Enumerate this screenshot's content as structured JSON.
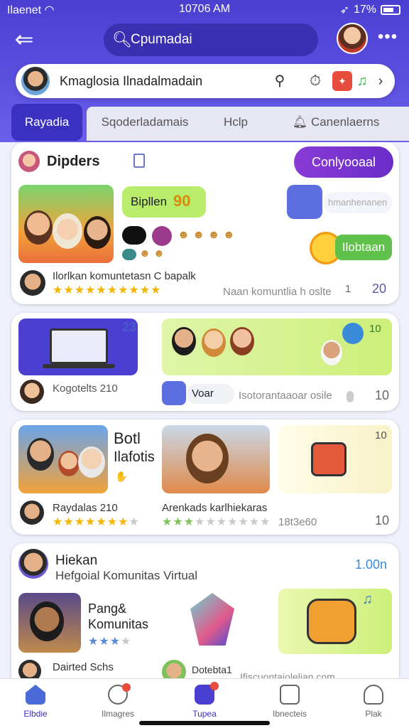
{
  "status": {
    "carrier": "Ilaenet",
    "time": "10706 AM",
    "battery": "17%"
  },
  "topbar": {
    "search_text": "Cpumadai"
  },
  "profile": {
    "name": "Kmaglosia Ilnadalmadain"
  },
  "tabs": [
    {
      "label": "Rayadia",
      "active": true
    },
    {
      "label": "Sqoderladamais",
      "active": false
    },
    {
      "label": "Hclp",
      "active": false
    },
    {
      "label": "Canenlaerns",
      "active": false
    }
  ],
  "card1": {
    "title": "Dipders",
    "cta": "Conlyooaal",
    "chip": "Bipllen",
    "chip_num": "90",
    "bubble": "hmanhenanen",
    "green_btn": "Ilobtaan",
    "caption": "Ilorlkan komuntetasn C bapalk",
    "caption_right": "Naan komuntlia h oslte",
    "count_a": "1",
    "count_b": "20",
    "rating": 4.5
  },
  "card2": {
    "badge_num": "23",
    "right_num": "10",
    "label_left": "Kogotelts 210",
    "label_mid": "Voar",
    "label_right": "Isotorantaaoar osile",
    "count": "10"
  },
  "card3": {
    "title_line1": "Botl",
    "title_line2": "Ilafotis",
    "right_num": "10",
    "label_left": "Raydalas 210",
    "label_mid": "Arenkads karlhiekaras",
    "label_mid2": "18t3e60",
    "count": "10",
    "rating_left": 4.5,
    "rating_mid": 2.5
  },
  "card4": {
    "title": "Hiekan",
    "subtitle": "Hefgoial Komunitas Virtual",
    "right_num": "1.00n",
    "block_title1": "Pang&",
    "block_title2": "Komunitas",
    "row_left": "Dairted Schs",
    "row_right": "Dotebta1",
    "row_right2": "Ifiscuontaiolelian.com",
    "rating": 3
  },
  "bottomnav": [
    {
      "label": "Elbdie",
      "active": true
    },
    {
      "label": "Ilmagres",
      "active": false
    },
    {
      "label": "Tupea",
      "active": false
    },
    {
      "label": "Ibnecteis",
      "active": false
    },
    {
      "label": "Plak",
      "active": false
    }
  ],
  "colors": {
    "primary": "#4a3fd1",
    "accent": "#8a3bd6",
    "green": "#5fc04a",
    "star": "#f5b400"
  }
}
